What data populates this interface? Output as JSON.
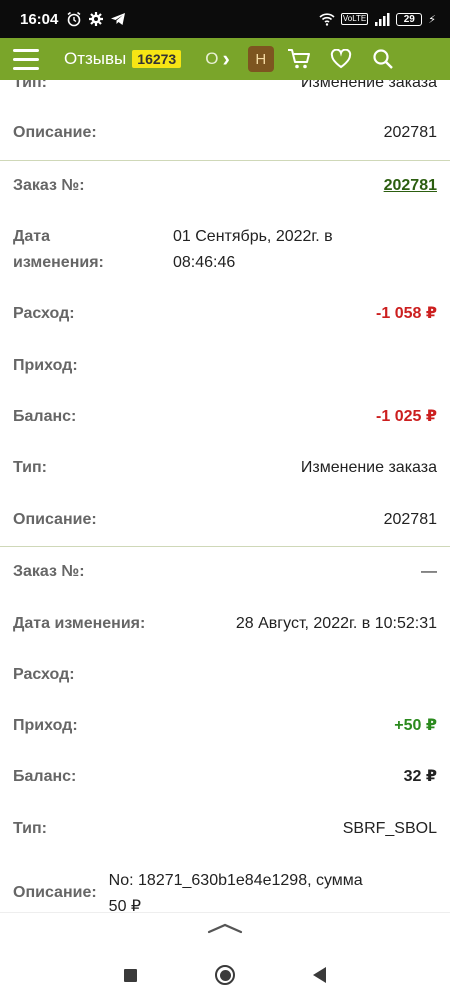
{
  "status_bar": {
    "time": "16:04",
    "battery": "29"
  },
  "header": {
    "reviews_label": "Отзывы",
    "reviews_count": "16273",
    "clipped_text": "О",
    "user_initial": "Н"
  },
  "top_partial": {
    "type_label": "Тип:",
    "type_value": "Изменение заказа",
    "desc_label": "Описание:",
    "desc_value": "202781"
  },
  "transactions": [
    {
      "order_label": "Заказ №:",
      "order_value": "202781",
      "date_label_1": "Дата",
      "date_label_2": "изменения:",
      "date_value_1": "01 Сентябрь, 2022г. в",
      "date_value_2": "08:46:46",
      "expense_label": "Расход:",
      "expense_value": "-1 058 ₽",
      "income_label": "Приход:",
      "income_value": "",
      "balance_label": "Баланс:",
      "balance_value": "-1 025 ₽",
      "type_label": "Тип:",
      "type_value": "Изменение заказа",
      "desc_label": "Описание:",
      "desc_value": "202781"
    },
    {
      "order_label": "Заказ №:",
      "order_value": "—",
      "date_label": "Дата изменения:",
      "date_value": "28 Август, 2022г. в 10:52:31",
      "expense_label": "Расход:",
      "expense_value": "",
      "income_label": "Приход:",
      "income_value": "+50 ₽",
      "balance_label": "Баланс:",
      "balance_value": "32 ₽",
      "type_label": "Тип:",
      "type_value": "SBRF_SBOL",
      "desc_label": "Описание:",
      "desc_value_1": "No: 18271_630b1e84e1298, сумма",
      "desc_value_2": "50 ₽"
    }
  ],
  "icons": [
    "alarm-icon",
    "gear-icon",
    "telegram-icon",
    "wifi-icon",
    "signal-icon",
    "battery-icon",
    "menu-icon",
    "chevron-right-icon",
    "cart-icon",
    "heart-icon",
    "search-icon",
    "chevron-up-icon",
    "recents-icon",
    "home-icon",
    "back-icon"
  ],
  "colors": {
    "header_bg": "#7aa52a",
    "badge_bg": "#f6e514",
    "negative": "#cc1f1f",
    "positive": "#2b8a1e",
    "link": "#2c5e10"
  }
}
